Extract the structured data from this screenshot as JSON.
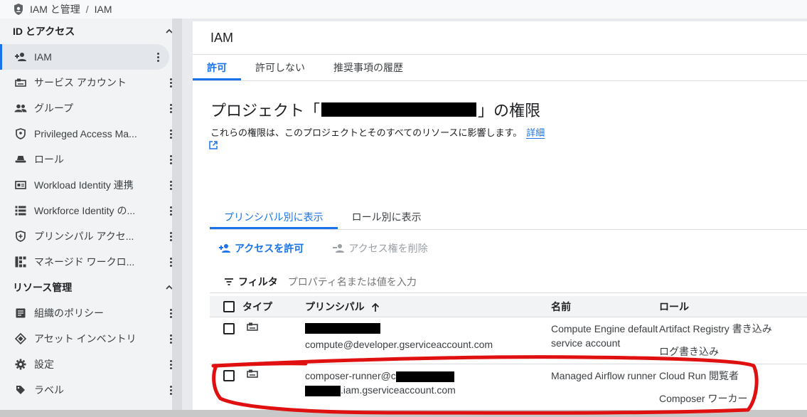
{
  "breadcrumb": {
    "product": "IAM と管理",
    "separator": "/",
    "current": "IAM"
  },
  "sidebar": {
    "section1_title": "ID とアクセス",
    "items1": [
      {
        "label": "IAM",
        "icon": "add-person-icon"
      },
      {
        "label": "サービス アカウント",
        "icon": "service-account-icon"
      },
      {
        "label": "グループ",
        "icon": "group-icon"
      },
      {
        "label": "Privileged Access Ma...",
        "icon": "shield-icon"
      },
      {
        "label": "ロール",
        "icon": "role-hat-icon"
      },
      {
        "label": "Workload Identity 連携",
        "icon": "workload-identity-icon"
      },
      {
        "label": "Workforce Identity の...",
        "icon": "list-icon"
      },
      {
        "label": "プリンシパル アクセ...",
        "icon": "principal-access-icon"
      },
      {
        "label": "マネージド ワークロ...",
        "icon": "grid-icon"
      }
    ],
    "section2_title": "リソース管理",
    "items2": [
      {
        "label": "組織のポリシー",
        "icon": "document-icon"
      },
      {
        "label": "アセット インベントリ",
        "icon": "diamond-icon"
      },
      {
        "label": "設定",
        "icon": "gear-icon"
      },
      {
        "label": "ラベル",
        "icon": "label-icon"
      }
    ]
  },
  "main": {
    "title": "IAM",
    "tabs": [
      "許可",
      "許可しない",
      "推奨事項の履歴"
    ],
    "permissions_title_prefix": "プロジェクト「",
    "permissions_title_suffix": "」の権限",
    "description": "これらの権限は、このプロジェクトとそのすべてのリソースに影響します。",
    "details_link": "詳細",
    "view_tabs": [
      "プリンシパル別に表示",
      "ロール別に表示"
    ],
    "grant_access": "アクセスを許可",
    "remove_access": "アクセス権を削除",
    "filter_label": "フィルタ",
    "filter_placeholder": "プロパティ名または値を入力"
  },
  "table": {
    "headers": {
      "type": "タイプ",
      "principal": "プリンシパル",
      "name": "名前",
      "role": "ロール"
    },
    "rows": [
      {
        "principal_line2": "compute@developer.gserviceaccount.com",
        "name": "Compute Engine default service account",
        "roles": [
          "Artifact Registry 書き込み",
          "ログ書き込み"
        ]
      },
      {
        "principal_line1": "composer-runner@c",
        "principal_line2": ".iam.gserviceaccount.com",
        "name": "Managed Airflow runner",
        "roles": [
          "Cloud Run 閲覧者",
          "Composer ワーカー"
        ]
      }
    ]
  },
  "colors": {
    "accent": "#1a73e8",
    "annotation": "#e01010"
  }
}
